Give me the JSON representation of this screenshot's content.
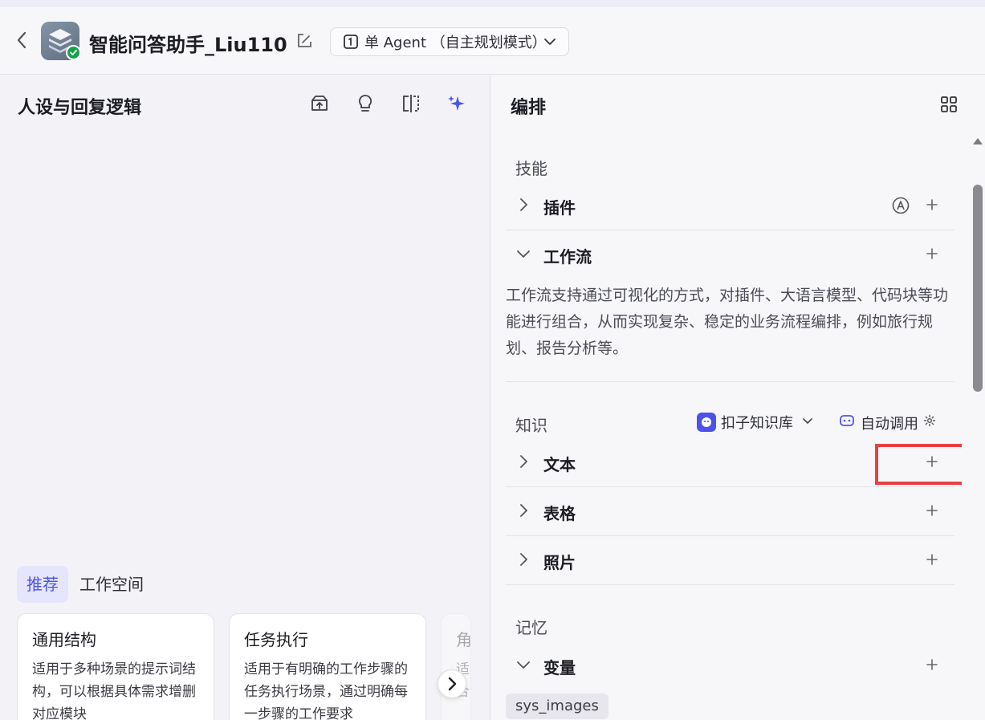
{
  "header": {
    "app_name": "智能问答助手_Liu110",
    "mode_label": "单 Agent （自主规划模式）"
  },
  "left_panel": {
    "title": "人设与回复逻辑",
    "tabs": [
      {
        "label": "推荐",
        "active": true
      },
      {
        "label": "工作空间",
        "active": false
      }
    ],
    "cards": [
      {
        "title": "通用结构",
        "desc": "适用于多种场景的提示词结构，可以根据具体需求增删对应模块"
      },
      {
        "title": "任务执行",
        "desc": "适用于有明确的工作步骤的任务执行场景，通过明确每一步骤的工作要求"
      },
      {
        "title": "角",
        "desc": "适合"
      }
    ]
  },
  "right_panel": {
    "title": "编排",
    "skills": {
      "label": "技能",
      "plugin_label": "插件",
      "workflow_label": "工作流",
      "workflow_desc": "工作流支持通过可视化的方式，对插件、大语言模型、代码块等功能进行组合，从而实现复杂、稳定的业务流程编排，例如旅行规划、报告分析等。"
    },
    "knowledge": {
      "label": "知识",
      "source_label": "扣子知识库",
      "auto_call_label": "自动调用",
      "text_label": "文本",
      "table_label": "表格",
      "photo_label": "照片"
    },
    "memory": {
      "label": "记忆",
      "variable_label": "变量",
      "variable_chip": "sys_images"
    }
  },
  "colors": {
    "accent": "#4d53e8",
    "highlight": "#e8413f",
    "success": "#14a34a"
  }
}
